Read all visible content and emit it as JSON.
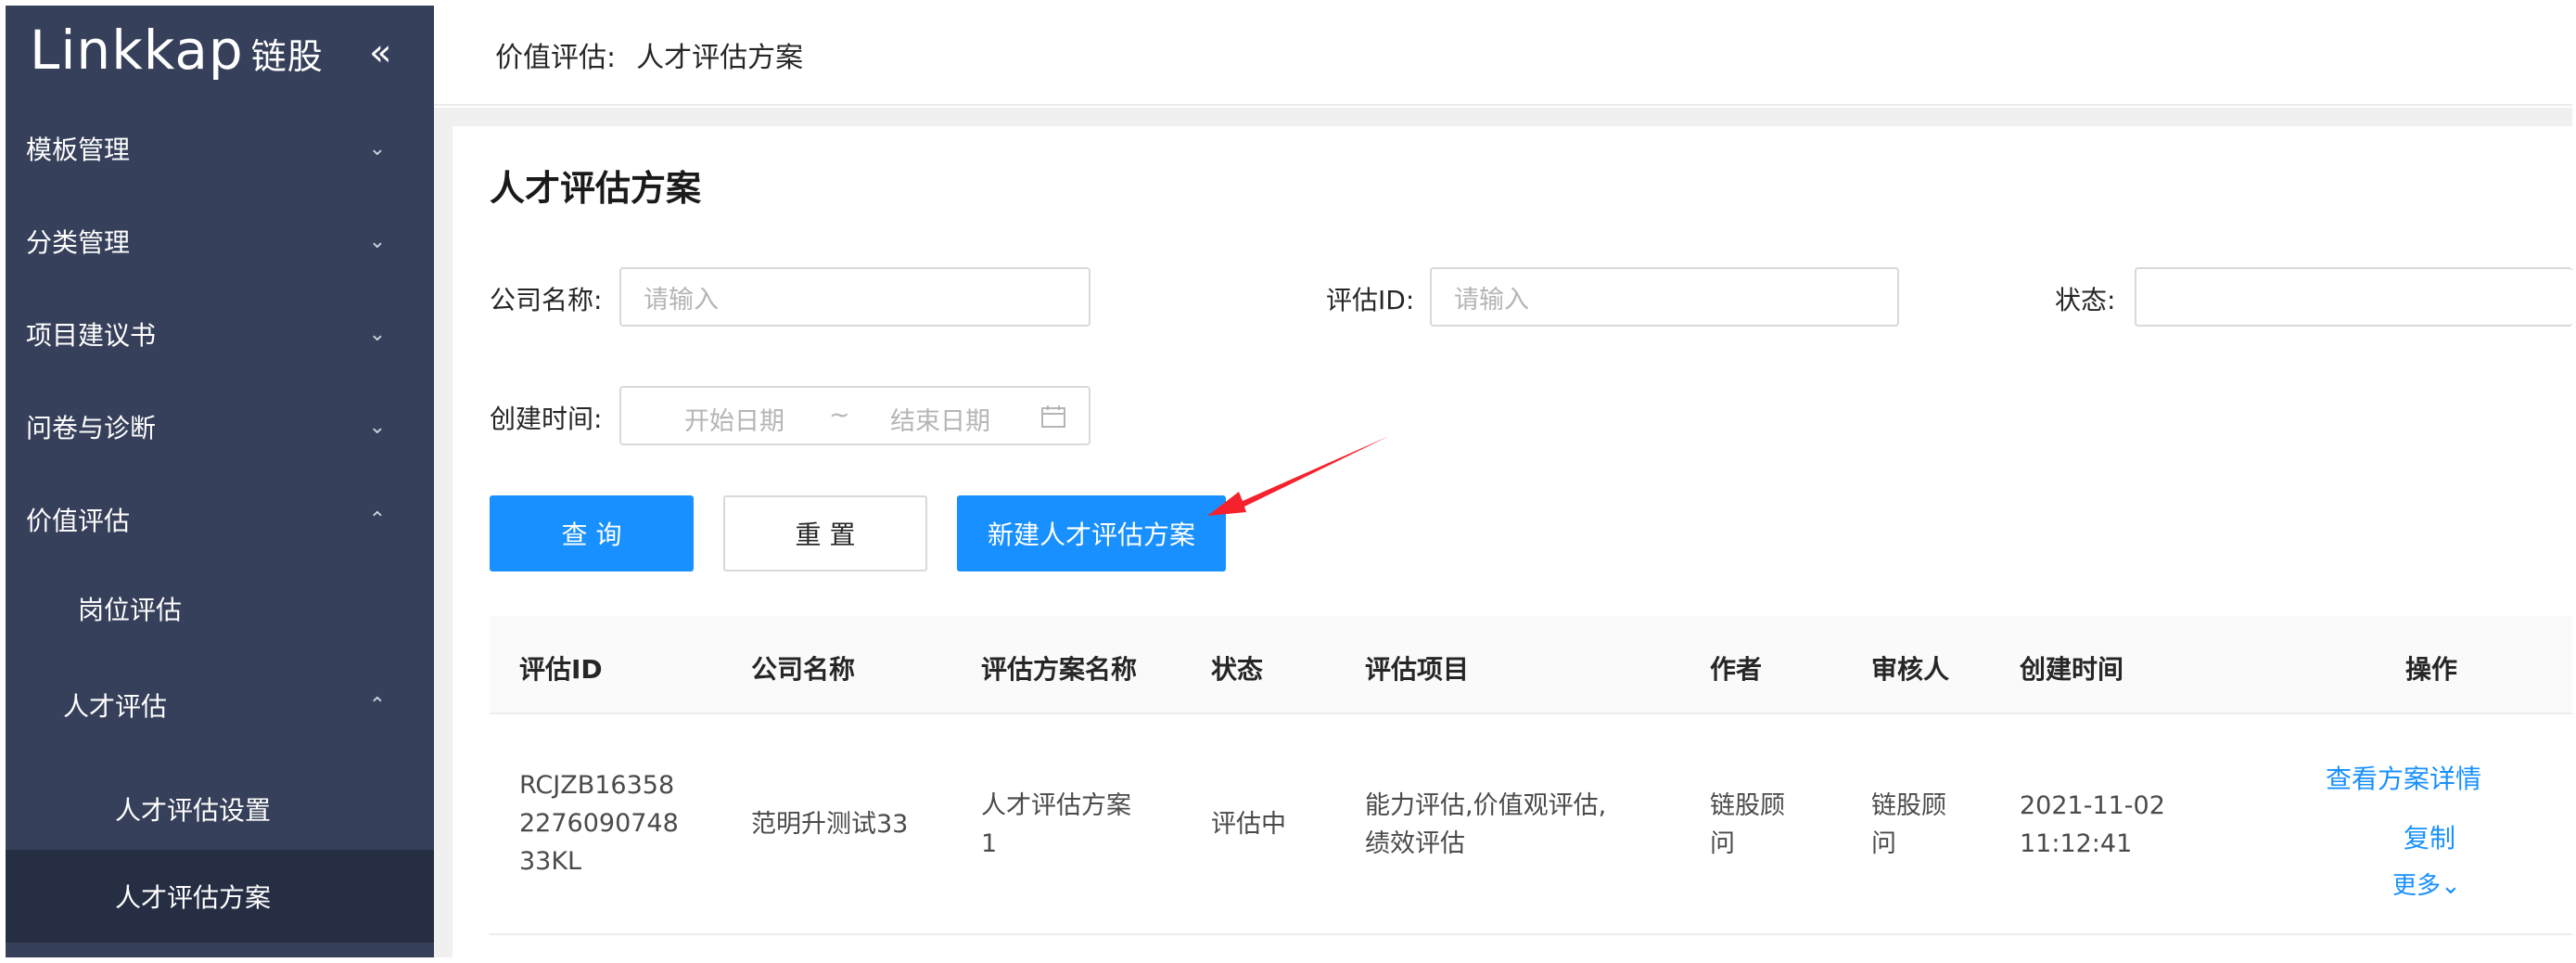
{
  "sidebar": {
    "logo_main": "Linkkap",
    "logo_cn": "链股",
    "collapse_icon": "«",
    "items": [
      {
        "label": "模板管理",
        "chevron": "⌄"
      },
      {
        "label": "分类管理",
        "chevron": "⌄"
      },
      {
        "label": "项目建议书",
        "chevron": "⌄"
      },
      {
        "label": "问卷与诊断",
        "chevron": "⌄"
      },
      {
        "label": "价值评估",
        "chevron": "⌃"
      },
      {
        "label": "岗位评估"
      },
      {
        "label": "人才评估",
        "chevron": "⌃"
      },
      {
        "label": "人才评估设置"
      },
      {
        "label": "人才评估方案"
      }
    ]
  },
  "header": {
    "breadcrumb_parent": "价值评估:",
    "breadcrumb_current": "人才评估方案"
  },
  "page": {
    "title": "人才评估方案"
  },
  "filters": {
    "company_label": "公司名称:",
    "company_placeholder": "请输入",
    "id_label": "评估ID:",
    "id_placeholder": "请输入",
    "status_label": "状态:",
    "status_value": "",
    "created_label": "创建时间:",
    "start_placeholder": "开始日期",
    "range_sep": "~",
    "end_placeholder": "结束日期"
  },
  "buttons": {
    "query": "查 询",
    "reset": "重 置",
    "create": "新建人才评估方案"
  },
  "table": {
    "headers": [
      "评估ID",
      "公司名称",
      "评估方案名称",
      "状态",
      "评估项目",
      "作者",
      "审核人",
      "创建时间",
      "操作"
    ],
    "rows": [
      {
        "id_lines": [
          "RCJZB16358",
          "2276090748",
          "33KL"
        ],
        "company": "范明升测试33",
        "plan_lines": [
          "人才评估方案",
          "1"
        ],
        "status": "评估中",
        "items_lines": [
          "能力评估,价值观评估,",
          "绩效评估"
        ],
        "author_lines": [
          "链股顾",
          "问"
        ],
        "reviewer_lines": [
          "链股顾",
          "问"
        ],
        "created_lines": [
          "2021-11-02",
          "11:12:41"
        ],
        "actions": {
          "view": "查看方案详情",
          "copy": "复制",
          "more": "更多⌄"
        }
      }
    ]
  },
  "colors": {
    "sidebar_bg": "#37405a",
    "sidebar_active": "#262e44",
    "primary": "#1890ff",
    "annotation_arrow": "#f5222d"
  }
}
